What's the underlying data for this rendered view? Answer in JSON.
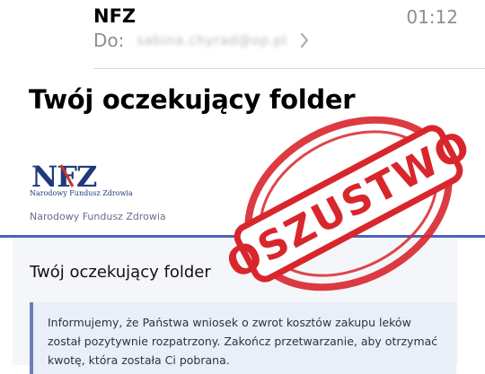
{
  "header": {
    "sender": "NFZ",
    "time": "01:12",
    "to_label": "Do:",
    "recipient": "sabina.chyrad@op.pl"
  },
  "email": {
    "subject": "Twój oczekujący folder",
    "logo_text": "NFZ",
    "logo_caption": "Narodowy Fundusz Zdrowia",
    "org_name": "Narodowy Fundusz Zdrowia",
    "folder_title": "Twój oczekujący folder",
    "notice": "Informujemy, że Państwa wniosek o zwrot kosztów zakupu leków został pozytywnie rozpatrzony. Zakończ przetwarzanie, aby otrzymać kwotę, która została Ci pobrana."
  },
  "stamp": {
    "text": "OSZUSTWO",
    "color": "#d8262c"
  },
  "colors": {
    "accent_rule": "#4a63b5",
    "logo_blue": "#1f3a7a",
    "logo_red": "#c0392b"
  },
  "icons": {
    "recipient_chevron": "chevron-right-icon"
  }
}
